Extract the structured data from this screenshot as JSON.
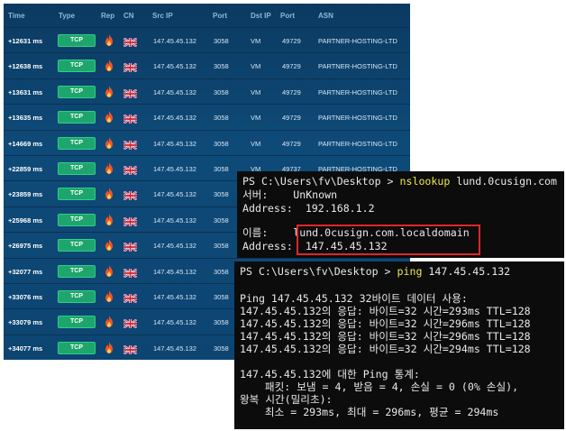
{
  "table": {
    "headers": {
      "time": "Time",
      "type": "Type",
      "rep": "Rep",
      "cn": "CN",
      "src_ip": "Src IP",
      "port1": "Port",
      "dst_ip": "Dst IP",
      "port2": "Port",
      "asn": "ASN"
    },
    "rows": [
      {
        "time": "+12631 ms",
        "type": "TCP",
        "rep_icon": "flame-icon",
        "country_icon": "uk-flag-icon",
        "src_ip": "147.45.45.132",
        "src_port": "3058",
        "dst_ip": "VM",
        "dst_port": "49729",
        "asn": "PARTNER-HOSTING-LTD"
      },
      {
        "time": "+12638 ms",
        "type": "TCP",
        "rep_icon": "flame-icon",
        "country_icon": "uk-flag-icon",
        "src_ip": "147.45.45.132",
        "src_port": "3058",
        "dst_ip": "VM",
        "dst_port": "49729",
        "asn": "PARTNER-HOSTING-LTD"
      },
      {
        "time": "+13631 ms",
        "type": "TCP",
        "rep_icon": "flame-icon",
        "country_icon": "uk-flag-icon",
        "src_ip": "147.45.45.132",
        "src_port": "3058",
        "dst_ip": "VM",
        "dst_port": "49729",
        "asn": "PARTNER-HOSTING-LTD"
      },
      {
        "time": "+13635 ms",
        "type": "TCP",
        "rep_icon": "flame-icon",
        "country_icon": "uk-flag-icon",
        "src_ip": "147.45.45.132",
        "src_port": "3058",
        "dst_ip": "VM",
        "dst_port": "49729",
        "asn": "PARTNER-HOSTING-LTD"
      },
      {
        "time": "+14669 ms",
        "type": "TCP",
        "rep_icon": "flame-icon",
        "country_icon": "uk-flag-icon",
        "src_ip": "147.45.45.132",
        "src_port": "3058",
        "dst_ip": "VM",
        "dst_port": "49729",
        "asn": "PARTNER-HOSTING-LTD"
      },
      {
        "time": "+22859 ms",
        "type": "TCP",
        "rep_icon": "flame-icon",
        "country_icon": "uk-flag-icon",
        "src_ip": "147.45.45.132",
        "src_port": "3058",
        "dst_ip": "VM",
        "dst_port": "49737",
        "asn": "PARTNER-HOSTING-LTD"
      },
      {
        "time": "+23859 ms",
        "type": "TCP",
        "rep_icon": "flame-icon",
        "country_icon": "uk-flag-icon",
        "src_ip": "147.45.45.132",
        "src_port": "3058",
        "dst_ip": "",
        "dst_port": "",
        "asn": ""
      },
      {
        "time": "+25968 ms",
        "type": "TCP",
        "rep_icon": "flame-icon",
        "country_icon": "uk-flag-icon",
        "src_ip": "147.45.45.132",
        "src_port": "3058",
        "dst_ip": "",
        "dst_port": "",
        "asn": ""
      },
      {
        "time": "+26975 ms",
        "type": "TCP",
        "rep_icon": "flame-icon",
        "country_icon": "uk-flag-icon",
        "src_ip": "147.45.45.132",
        "src_port": "3058",
        "dst_ip": "",
        "dst_port": "",
        "asn": ""
      },
      {
        "time": "+32077 ms",
        "type": "TCP",
        "rep_icon": "flame-icon",
        "country_icon": "uk-flag-icon",
        "src_ip": "147.45.45.132",
        "src_port": "3058",
        "dst_ip": "",
        "dst_port": "",
        "asn": ""
      },
      {
        "time": "+33076 ms",
        "type": "TCP",
        "rep_icon": "flame-icon",
        "country_icon": "uk-flag-icon",
        "src_ip": "147.45.45.132",
        "src_port": "3058",
        "dst_ip": "",
        "dst_port": "",
        "asn": ""
      },
      {
        "time": "+33079 ms",
        "type": "TCP",
        "rep_icon": "flame-icon",
        "country_icon": "uk-flag-icon",
        "src_ip": "147.45.45.132",
        "src_port": "3058",
        "dst_ip": "",
        "dst_port": "",
        "asn": ""
      },
      {
        "time": "+34077 ms",
        "type": "TCP",
        "rep_icon": "flame-icon",
        "country_icon": "uk-flag-icon",
        "src_ip": "147.45.45.132",
        "src_port": "3058",
        "dst_ip": "",
        "dst_port": "",
        "asn": ""
      }
    ]
  },
  "nslookup_terminal": {
    "prompt": "PS C:\\Users\\fv\\Desktop > ",
    "command": "nslookup",
    "argument": " lund.0cusign.com",
    "server_label": "서버:    ",
    "server_value": "UnKnown",
    "address_label": "Address:  ",
    "address_value": "192.168.1.2",
    "name_label": "이름:    ",
    "name_value": "lund.0cusign.com.localdomain",
    "result_address_label": "Address:  ",
    "result_address_value": "147.45.45.132"
  },
  "ping_terminal": {
    "prompt": "PS C:\\Users\\fv\\Desktop > ",
    "command": "ping",
    "argument": " 147.45.45.132",
    "header": "Ping 147.45.45.132 32바이트 데이터 사용:",
    "replies": [
      "147.45.45.132의 응답: 바이트=32 시간=293ms TTL=128",
      "147.45.45.132의 응답: 바이트=32 시간=296ms TTL=128",
      "147.45.45.132의 응답: 바이트=32 시간=296ms TTL=128",
      "147.45.45.132의 응답: 바이트=32 시간=294ms TTL=128"
    ],
    "stats_title": "147.45.45.132에 대한 Ping 통계:",
    "packets": "    패킷: 보냄 = 4, 받음 = 4, 손실 = 0 (0% 손실),",
    "rtt_title": "왕복 시간(밀리초):",
    "rtt_values": "    최소 = 293ms, 최대 = 296ms, 평균 = 294ms"
  },
  "colors": {
    "table_bg": "#0e4a78",
    "tcp_badge": "#1ea56c",
    "command_yellow": "#f0e64a",
    "highlight_border": "#e0262a",
    "terminal_bg": "#0c0c0c"
  }
}
